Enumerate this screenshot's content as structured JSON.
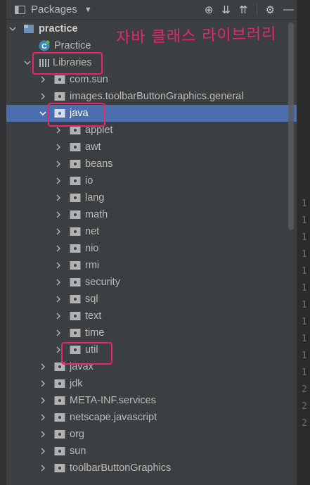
{
  "toolbar": {
    "title": "Packages",
    "icons": [
      "locate-icon",
      "expand-all-icon",
      "collapse-all-icon",
      "settings-icon",
      "minimize-icon"
    ]
  },
  "annotation_text": "자바 클래스 라이브러리",
  "tree": {
    "project": "practice",
    "practice_class": "Practice",
    "libraries": "Libraries",
    "packages": [
      "com.sun",
      "images.toolbarButtonGraphics.general",
      "java",
      "applet",
      "awt",
      "beans",
      "io",
      "lang",
      "math",
      "net",
      "nio",
      "rmi",
      "security",
      "sql",
      "text",
      "time",
      "util",
      "javax",
      "jdk",
      "META-INF.services",
      "netscape.javascript",
      "org",
      "sun",
      "toolbarButtonGraphics"
    ]
  },
  "gutter_numbers": [
    "1",
    "1",
    "1",
    "1",
    "1",
    "1",
    "1",
    "1",
    "1",
    "1",
    "1",
    "2",
    "2",
    "2"
  ],
  "colors": {
    "selection": "#4b6eaf",
    "annotation": "#e8256e",
    "background": "#3c3f41"
  }
}
